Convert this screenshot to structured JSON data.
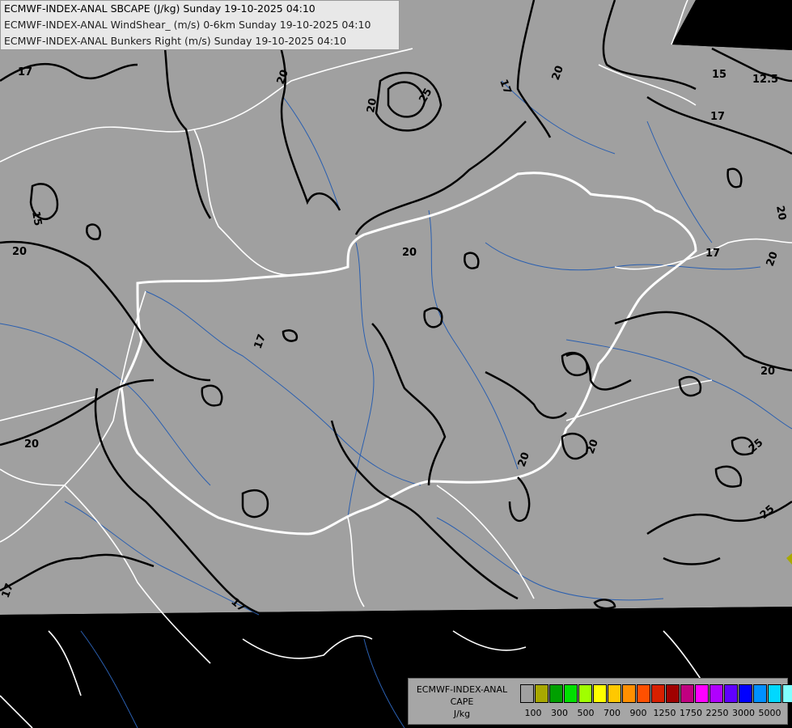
{
  "header": {
    "line1": "ECMWF-INDEX-ANAL SBCAPE (J/kg) Sunday 19-10-2025 04:10",
    "line2": "ECMWF-INDEX-ANAL WindShear_ (m/s) 0-6km Sunday 19-10-2025 04:10",
    "line3": "ECMWF-INDEX-ANAL Bunkers Right (m/s) Sunday 19-10-2025 04:10"
  },
  "map": {
    "background_color": "#a0a0a0",
    "outside_color": "#000000",
    "border_color": "#ffffff",
    "river_color": "#2a5fb0",
    "contour_color": "#000000",
    "contour_labels": [
      "17",
      "20",
      "25",
      "15",
      "12.5",
      "17",
      "20",
      "20",
      "25",
      "17",
      "20",
      "20",
      "15",
      "17",
      "20",
      "20",
      "20",
      "20",
      "17",
      "20",
      "20",
      "20",
      "20",
      "20",
      "25",
      "25",
      "17",
      "17"
    ]
  },
  "legend": {
    "title_line1": "ECMWF-INDEX-ANAL",
    "title_line2": "CAPE",
    "title_line3": "J/kg",
    "colors": [
      "#a0a0a0",
      "#a8a800",
      "#00a000",
      "#00e000",
      "#a0ff00",
      "#ffff00",
      "#ffc800",
      "#ff9000",
      "#ff5000",
      "#d82000",
      "#a00000",
      "#c00080",
      "#ff00ff",
      "#b000ff",
      "#6000ff",
      "#0000ff",
      "#0090ff",
      "#00d8ff",
      "#80ffff",
      "#ffffff"
    ],
    "tick_labels": [
      "100",
      "300",
      "500",
      "700",
      "900",
      "1250",
      "1750",
      "2250",
      "3000",
      "5000"
    ]
  }
}
